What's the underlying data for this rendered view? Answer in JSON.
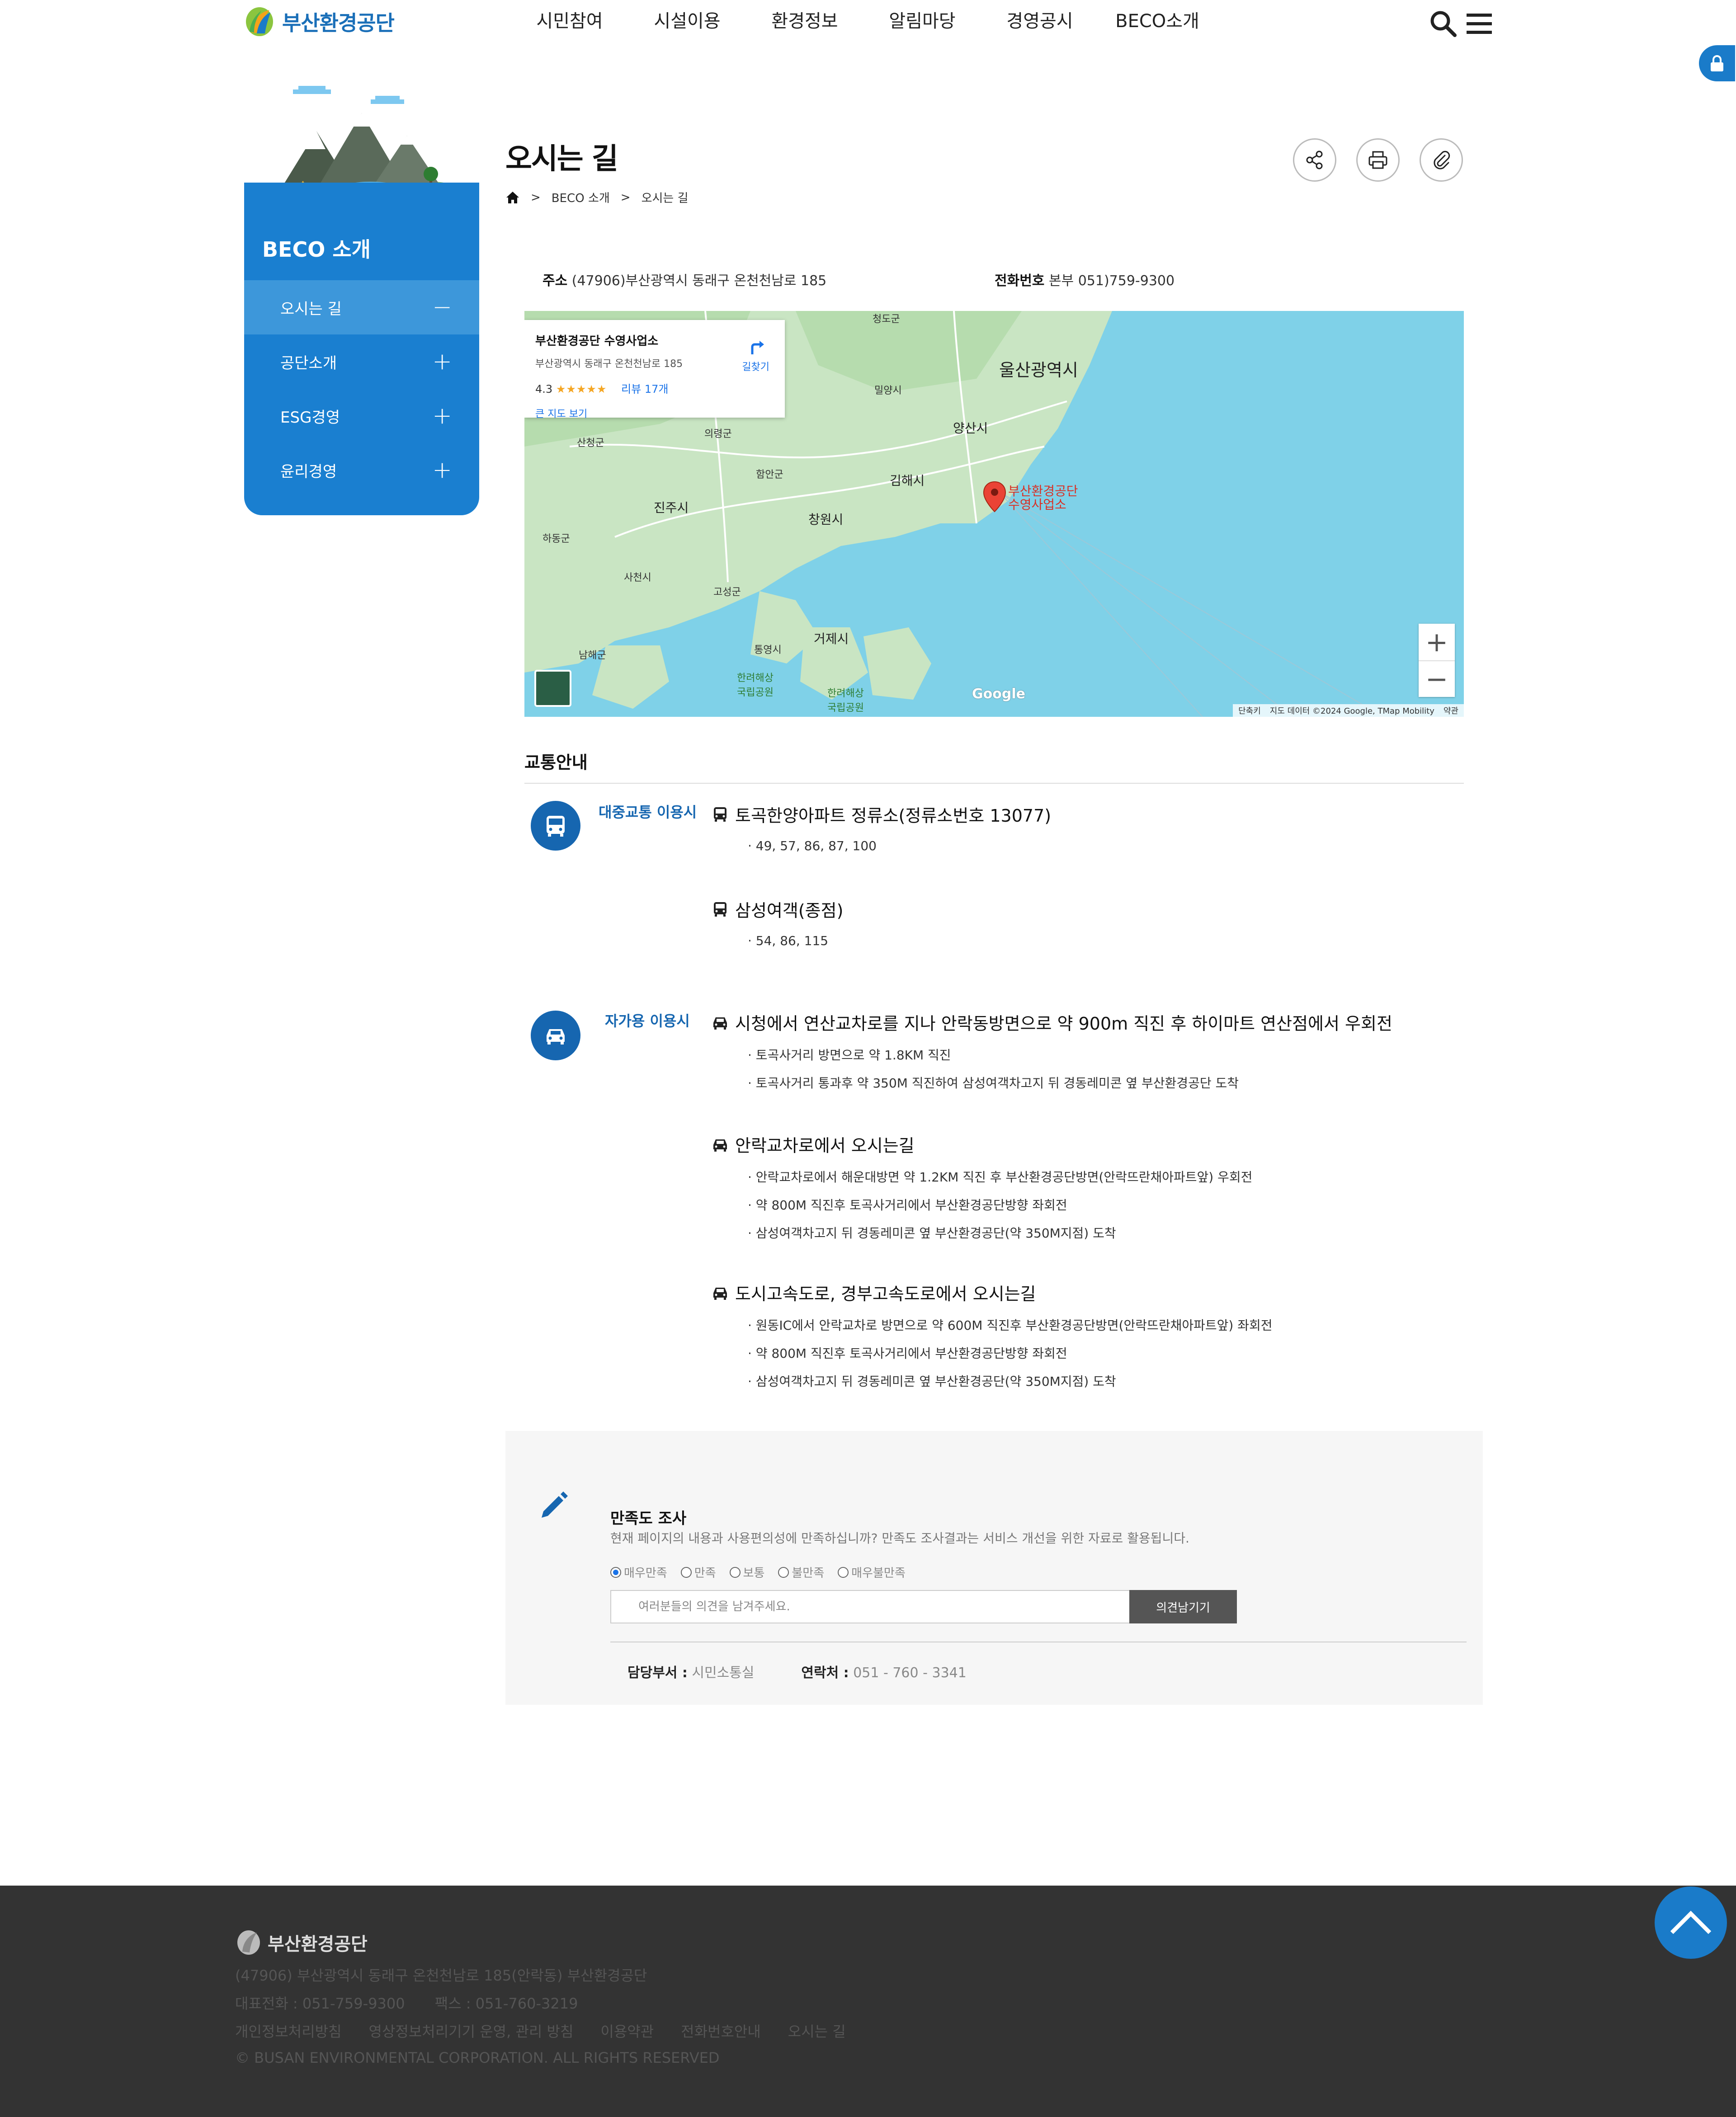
{
  "header": {
    "logo_text": "부산환경공단",
    "nav": [
      "시민참여",
      "시설이용",
      "환경정보",
      "알림마당",
      "경영공시",
      "BECO소개"
    ]
  },
  "sidebar": {
    "title": "BECO 소개",
    "items": [
      {
        "label": "오시는 길",
        "sign": "−"
      },
      {
        "label": "공단소개",
        "sign": "+"
      },
      {
        "label": "ESG경영",
        "sign": "+"
      },
      {
        "label": "윤리경영",
        "sign": "+"
      }
    ]
  },
  "page": {
    "title": "오시는 길",
    "breadcrumb": [
      "BECO 소개",
      "오시는 길"
    ],
    "breadcrumb_sep": ">"
  },
  "address": {
    "addr_label": "주소",
    "addr_value": "(47906)부산광역시 동래구 온천천남로 185",
    "tel_label": "전화번호",
    "tel_value": "본부 051)759-9300"
  },
  "map": {
    "card": {
      "name": "부산환경공단 수영사업소",
      "address": "부산광역시 동래구 온천천남로 185",
      "rating": "4.3",
      "stars": "★★★★★",
      "reviews": "리뷰 17개",
      "large_map": "큰 지도 보기",
      "directions": "길찾기"
    },
    "labels": {
      "ulsan": "울산광역시",
      "yangsan": "양산시",
      "gimhae": "김해시",
      "changwon": "창원시",
      "jinju": "진주시",
      "geoje": "거제시",
      "hadong": "하동군",
      "sacheon": "사천시",
      "goseong": "고성군",
      "tongyeong": "통영시",
      "namhae": "남해군",
      "uiryeong": "의령군",
      "haman": "함안군",
      "sancheong": "산청군",
      "miryang": "밀양시",
      "cheongdo": "청도군",
      "park1": "한려해상\n국립공원",
      "park2": "한려해상\n국립공원"
    },
    "marker_label": "부산환경공단\n수영사업소",
    "google": "Google",
    "footer": [
      "단축키",
      "지도 데이터 ©2024 Google, TMap Mobility",
      "약관"
    ],
    "zoom_in": "+",
    "zoom_out": "−"
  },
  "transport": {
    "title": "교통안내",
    "public": {
      "label": "대중교통 이용시",
      "routes": [
        {
          "head": "토곡한양아파트 정류소(정류소번호 13077)",
          "lines": [
            "· 49, 57, 86, 87, 100"
          ]
        },
        {
          "head": "삼성여객(종점)",
          "lines": [
            "· 54, 86, 115"
          ]
        }
      ]
    },
    "car": {
      "label": "자가용 이용시",
      "routes": [
        {
          "head": "시청에서 연산교차로를 지나 안락동방면으로 약 900m 직진 후 하이마트 연산점에서 우회전",
          "lines": [
            "· 토곡사거리 방면으로 약 1.8KM 직진",
            "· 토곡사거리 통과후 약 350M 직진하여 삼성여객차고지 뒤 경동레미콘 옆 부산환경공단 도착"
          ]
        },
        {
          "head": "안락교차로에서 오시는길",
          "lines": [
            "· 안락교차로에서 해운대방면 약 1.2KM 직진 후 부산환경공단방면(안락뜨란채아파트앞) 우회전",
            "· 약 800M 직진후 토곡사거리에서 부산환경공단방향 좌회전",
            "· 삼성여객차고지 뒤 경동레미콘 옆 부산환경공단(약 350M지점) 도착"
          ]
        },
        {
          "head": "도시고속도로, 경부고속도로에서 오시는길",
          "lines": [
            "· 원동IC에서 안락교차로 방면으로 약 600M 직진후 부산환경공단방면(안락뜨란채아파트앞) 좌회전",
            "· 약 800M 직진후 토곡사거리에서 부산환경공단방향 좌회전",
            "· 삼성여객차고지 뒤 경동레미콘 옆 부산환경공단(약 350M지점) 도착"
          ]
        }
      ]
    }
  },
  "survey": {
    "title": "만족도 조사",
    "desc": "현재 페이지의 내용과 사용편의성에 만족하십니까? 만족도 조사결과는 서비스 개선을 위한 자료로 활용됩니다.",
    "options": [
      "매우만족",
      "만족",
      "보통",
      "불만족",
      "매우불만족"
    ],
    "selected": "매우만족",
    "placeholder": "여러분들의 의견을 남겨주세요.",
    "submit": "의견남기기",
    "dept_label": "담당부서 :",
    "dept_value": "시민소통실",
    "contact_label": "연락처 :",
    "contact_value": "051 - 760 - 3341"
  },
  "footer": {
    "logo_text": "부산환경공단",
    "address": "(47906) 부산광역시 동래구 온천천남로 185(안락동) 부산환경공단",
    "tel": "대표전화 : 051-759-9300",
    "fax": "팩스 : 051-760-3219",
    "links": [
      "개인정보처리방침",
      "영상정보처리기기 운영, 관리 방침",
      "이용약관",
      "전화번호안내",
      "오시는 길"
    ],
    "copyright": "© BUSAN ENVIRONMENTAL CORPORATION. ALL RIGHTS RESERVED"
  },
  "colors": {
    "brand": "#1a7fd0",
    "brand_dark": "#1666b0",
    "footer_bg": "#333333"
  }
}
